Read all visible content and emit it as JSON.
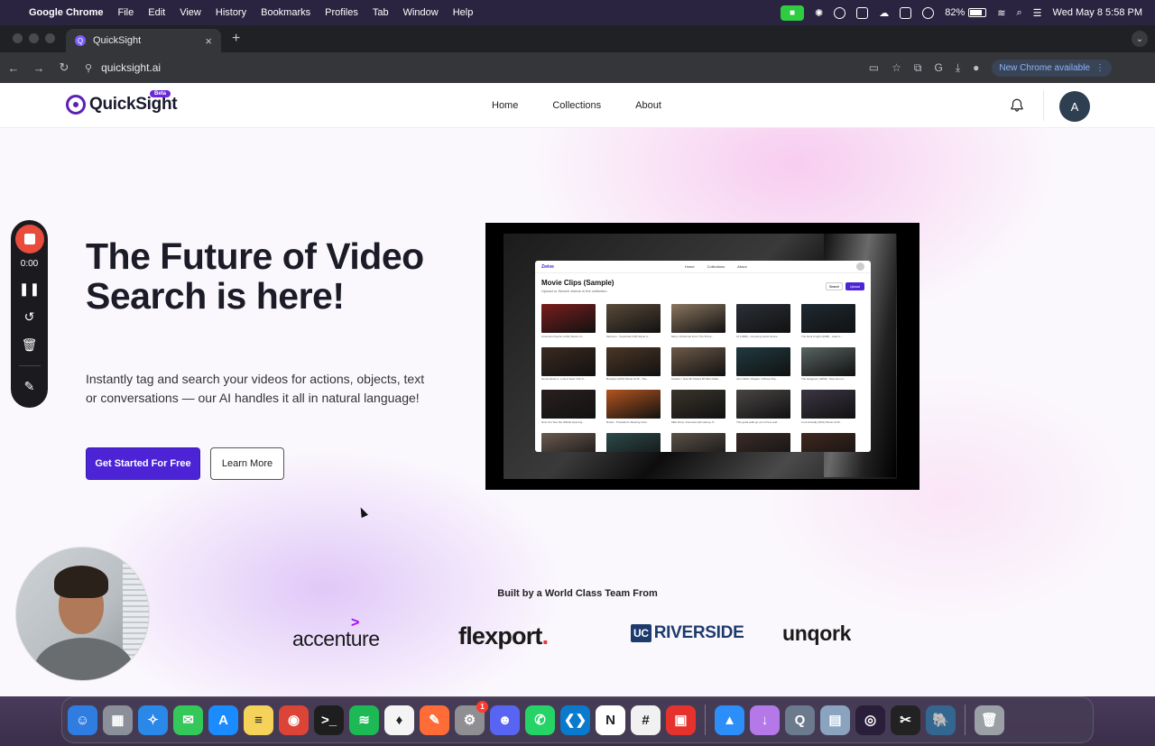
{
  "menubar": {
    "app": "Google Chrome",
    "items": [
      "File",
      "Edit",
      "View",
      "History",
      "Bookmarks",
      "Profiles",
      "Tab",
      "Window",
      "Help"
    ],
    "battery": "82%",
    "battery_level": 0.82,
    "datetime": "Wed May 8  5:58 PM"
  },
  "browser": {
    "tab_title": "QuickSight",
    "tab_favicon_letter": "Q",
    "url": "quicksight.ai",
    "update_label": "New Chrome available"
  },
  "site": {
    "brand": "QuickSight",
    "beta": "Beta",
    "nav": [
      "Home",
      "Collections",
      "About"
    ],
    "avatar_letter": "A",
    "hero_title": "The Future of Video Search is here!",
    "hero_sub": "Instantly tag and search your videos for actions, objects, text or conversations — our AI handles it all in natural language!",
    "cta_primary": "Get Started For Free",
    "cta_secondary": "Learn More",
    "built_by": "Built by a World Class Team From",
    "logos": {
      "accenture": "accenture",
      "flexport": "flexport",
      "ucr_uc": "UC",
      "ucr_name": "RIVERSIDE",
      "unqork": "unqork"
    }
  },
  "demo": {
    "brand": "Zwive",
    "links": [
      "Home",
      "Collections",
      "About"
    ],
    "title": "Movie Clips (Sample)",
    "subtitle": "Upload or Search videos in the collection.",
    "search_btn": "Search",
    "upload_btn": "Upload",
    "clips": [
      {
        "caption": "American Psycho (2/10) Movie Cl...",
        "color": "#7a1d1d"
      },
      {
        "caption": "Mercuen - Superbad (1/8) Movie C...",
        "color": "#5a4a3a"
      },
      {
        "caption": "Merry Christmas From The Prime...",
        "color": "#8a7560"
      },
      {
        "caption": "21 (2008) - Counting Cards Scene",
        "color": "#2b2f36"
      },
      {
        "caption": "The Dark Knight (2008) - Joker's...",
        "color": "#1e2a33"
      },
      {
        "caption": "Home Alone 2 - Lost in New York C...",
        "color": "#3b2a20"
      },
      {
        "caption": "Brooklyn (2/10) Movie CLIP - The...",
        "color": "#4b3626"
      },
      {
        "caption": "Caution / How Mr Kicked Mr Mini Clabs...",
        "color": "#6d5a48"
      },
      {
        "caption": "John Wick: Chapter 4 Movie Clip...",
        "color": "#203a40"
      },
      {
        "caption": "The Hangover (2009) - Nice Hon H...",
        "color": "#596462"
      },
      {
        "caption": "Now You See Me Official Opening...",
        "color": "#2a2020"
      },
      {
        "caption": "Rustic - President's Meeting Card",
        "color": "#b3541f"
      },
      {
        "caption": "Mike Ross: Interview with Harvey S...",
        "color": "#3a352c"
      },
      {
        "caption": "This gotta walk go out of here and...",
        "color": "#4a4545"
      },
      {
        "caption": "Love Actually (6/10) Movie CLIP...",
        "color": "#3c3644"
      },
      {
        "caption": "",
        "color": "#6a5a50"
      },
      {
        "caption": "",
        "color": "#2c4a4a"
      },
      {
        "caption": "",
        "color": "#5a5048"
      },
      {
        "caption": "",
        "color": "#3a2c28"
      },
      {
        "caption": "",
        "color": "#402820"
      }
    ]
  },
  "recorder": {
    "time": "0:00"
  },
  "dock": {
    "apps": [
      {
        "name": "finder",
        "color": "#2f7de1",
        "glyph": "☺"
      },
      {
        "name": "launchpad",
        "color": "#8a8f99",
        "glyph": "▦"
      },
      {
        "name": "safari",
        "color": "#2a88e8",
        "glyph": "✧"
      },
      {
        "name": "messages",
        "color": "#34c759",
        "glyph": "✉"
      },
      {
        "name": "app-store",
        "color": "#1a8cff",
        "glyph": "A"
      },
      {
        "name": "notes",
        "color": "#f5d35a",
        "glyph": "≡"
      },
      {
        "name": "chrome",
        "color": "#db4437",
        "glyph": "◉"
      },
      {
        "name": "terminal",
        "color": "#1e1e1e",
        "glyph": ">_"
      },
      {
        "name": "spotify",
        "color": "#1db954",
        "glyph": "≋"
      },
      {
        "name": "mongodb",
        "color": "#f4f4f4",
        "glyph": "♦"
      },
      {
        "name": "postman",
        "color": "#ff6c37",
        "glyph": "✎"
      },
      {
        "name": "system-settings",
        "color": "#8e8e93",
        "glyph": "⚙",
        "badge": "1"
      },
      {
        "name": "discord",
        "color": "#5865f2",
        "glyph": "☻"
      },
      {
        "name": "whatsapp",
        "color": "#25d366",
        "glyph": "✆"
      },
      {
        "name": "vscode",
        "color": "#0a7acc",
        "glyph": "❮❯"
      },
      {
        "name": "notion",
        "color": "#ffffff",
        "glyph": "N"
      },
      {
        "name": "slack",
        "color": "#f1f1f1",
        "glyph": "#"
      },
      {
        "name": "flashcards",
        "color": "#e5322d",
        "glyph": "▣"
      },
      {
        "name": "keynote",
        "color": "#2c8ef8",
        "glyph": "▲"
      },
      {
        "name": "downloads",
        "color": "#b478e8",
        "glyph": "↓"
      },
      {
        "name": "quicktime",
        "color": "#6b7a8c",
        "glyph": "Q"
      },
      {
        "name": "preview",
        "color": "#8aa4c0",
        "glyph": "▤"
      },
      {
        "name": "obs",
        "color": "#2a1f3a",
        "glyph": "◎"
      },
      {
        "name": "final-cut",
        "color": "#222",
        "glyph": "✂"
      },
      {
        "name": "postgres",
        "color": "#336791",
        "glyph": "🐘"
      },
      {
        "name": "trash",
        "color": "#9aa0a6",
        "glyph": "🗑"
      }
    ]
  }
}
